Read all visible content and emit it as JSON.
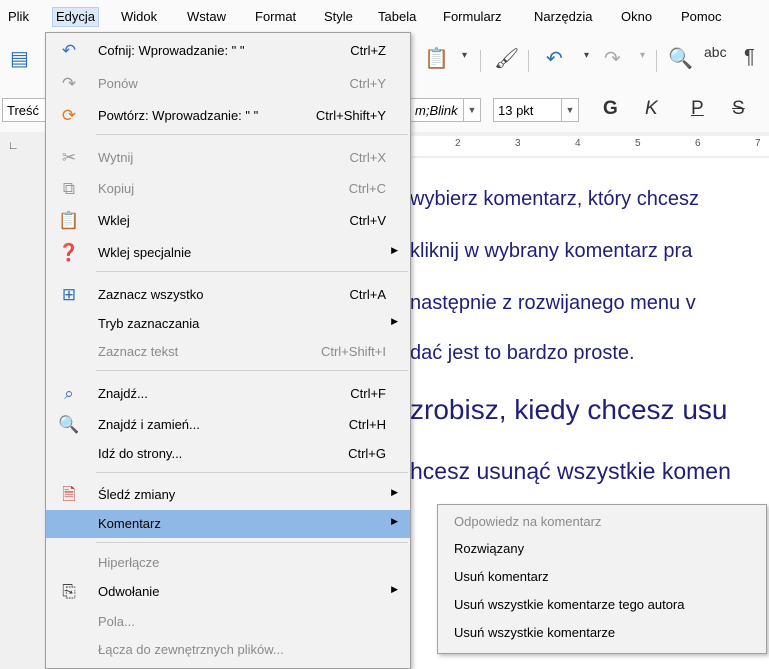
{
  "menubar": {
    "items": [
      "Plik",
      "Edycja",
      "Widok",
      "Wstaw",
      "Format",
      "Style",
      "Tabela",
      "Formularz",
      "Narzędzia",
      "Okno",
      "Pomoc"
    ]
  },
  "toolbar": {
    "paragraph_style": "Treść",
    "font_name": "m;Blink",
    "font_size": "13 pkt",
    "bold_label": "G",
    "italic_label": "K",
    "underline_label": "P",
    "strike_label": "S",
    "spellcheck_label": "abc"
  },
  "ruler": {
    "ticks": [
      "2",
      "3",
      "4",
      "5",
      "6",
      "7"
    ]
  },
  "document": {
    "lines": [
      "wybierz komentarz, który chcesz",
      "kliknij w wybrany komentarz pra",
      "następnie z rozwijanego menu v",
      "dać jest to bardzo proste.",
      "zrobisz, kiedy chcesz usu",
      "hcesz usunąć wszystkie komen"
    ]
  },
  "edit_menu": {
    "items": [
      {
        "label": "Cofnij: Wprowadzanie: \" \"",
        "shortcut": "Ctrl+Z",
        "icon": "undo-icon"
      },
      {
        "label": "Ponów",
        "shortcut": "Ctrl+Y",
        "icon": "redo-icon"
      },
      {
        "label": "Powtórz: Wprowadzanie: \" \"",
        "shortcut": "Ctrl+Shift+Y",
        "icon": "repeat-icon"
      },
      {
        "label": "Wytnij",
        "shortcut": "Ctrl+X",
        "icon": "cut-icon"
      },
      {
        "label": "Kopiuj",
        "shortcut": "Ctrl+C",
        "icon": "copy-icon"
      },
      {
        "label": "Wklej",
        "shortcut": "Ctrl+V",
        "icon": "paste-icon"
      },
      {
        "label": "Wklej specjalnie",
        "shortcut": "",
        "icon": "paste-special-icon"
      },
      {
        "label": "Zaznacz wszystko",
        "shortcut": "Ctrl+A",
        "icon": "select-all-icon"
      },
      {
        "label": "Tryb zaznaczania",
        "shortcut": "",
        "icon": ""
      },
      {
        "label": "Zaznacz tekst",
        "shortcut": "Ctrl+Shift+I",
        "icon": ""
      },
      {
        "label": "Znajdź...",
        "shortcut": "Ctrl+F",
        "icon": "find-icon"
      },
      {
        "label": "Znajdź i zamień...",
        "shortcut": "Ctrl+H",
        "icon": "find-replace-icon"
      },
      {
        "label": "Idź do strony...",
        "shortcut": "Ctrl+G",
        "icon": ""
      },
      {
        "label": "Śledź zmiany",
        "shortcut": "",
        "icon": "track-changes-icon"
      },
      {
        "label": "Komentarz",
        "shortcut": "",
        "icon": ""
      },
      {
        "label": "Hiperłącze",
        "shortcut": "",
        "icon": ""
      },
      {
        "label": "Odwołanie",
        "shortcut": "",
        "icon": "reference-icon"
      },
      {
        "label": "Pola...",
        "shortcut": "",
        "icon": ""
      },
      {
        "label": "Łącza do zewnętrznych plików...",
        "shortcut": "",
        "icon": ""
      }
    ]
  },
  "comment_submenu": {
    "items": [
      {
        "label": "Odpowiedz na komentarz"
      },
      {
        "label": "Rozwiązany"
      },
      {
        "label": "Usuń komentarz"
      },
      {
        "label": "Usuń wszystkie komentarze tego autora"
      },
      {
        "label": "Usuń wszystkie komentarze"
      }
    ]
  },
  "colors": {
    "menu_highlight": "#8fb8e6",
    "document_text": "#1f1f7a",
    "disabled_text": "#8a8a8a"
  }
}
